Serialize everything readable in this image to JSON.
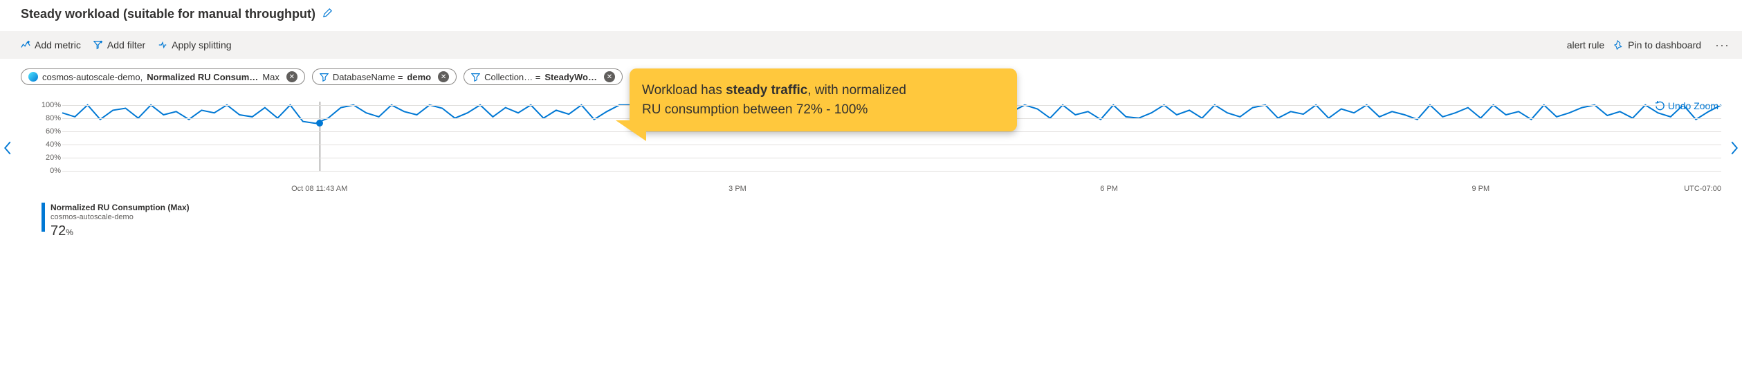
{
  "title": "Steady workload (suitable for manual throughput)",
  "toolbar": {
    "add_metric": "Add metric",
    "add_filter": "Add filter",
    "apply_split": "Apply splitting",
    "alert_rule": "alert rule",
    "pin_dash": "Pin to dashboard"
  },
  "pills": {
    "resource": "cosmos-autoscale-demo,",
    "metric": "Normalized RU Consum…",
    "agg": "Max",
    "filter1_key": "DatabaseName = ",
    "filter1_val": "demo",
    "filter2_key": "Collection… = ",
    "filter2_val": "SteadyWo…"
  },
  "callout": {
    "line1a": "Workload has ",
    "line1b": "steady traffic",
    "line1c": ", with normalized",
    "line2": "RU consumption between 72% - 100%"
  },
  "undo_zoom": "Undo Zoom",
  "timezone": "UTC-07:00",
  "legend": {
    "metric": "Normalized RU Consumption (Max)",
    "resource": "cosmos-autoscale-demo",
    "value": "72",
    "unit": "%"
  },
  "chart_data": {
    "type": "line",
    "ylabel": "",
    "ylim": [
      0,
      105
    ],
    "yticks": [
      0,
      20,
      40,
      60,
      80,
      100
    ],
    "ytick_labels": [
      "0%",
      "20%",
      "40%",
      "60%",
      "80%",
      "100%"
    ],
    "x_ticks": [
      "Oct 08 11:43 AM",
      "3 PM",
      "6 PM",
      "9 PM"
    ],
    "x_tick_positions_pct": [
      15.5,
      40.7,
      63.1,
      85.5
    ],
    "cursor_x_pct": 15.5,
    "cursor_y_val": 72,
    "series": [
      {
        "name": "Normalized RU Consumption (Max)",
        "color": "#0078d4",
        "values": [
          88,
          82,
          100,
          78,
          92,
          95,
          80,
          100,
          85,
          90,
          78,
          92,
          88,
          100,
          85,
          82,
          96,
          80,
          100,
          75,
          72,
          80,
          96,
          100,
          88,
          82,
          100,
          90,
          85,
          100,
          95,
          80,
          88,
          100,
          82,
          96,
          88,
          100,
          80,
          92,
          86,
          100,
          78,
          90,
          100,
          100,
          85,
          78,
          80,
          100,
          82,
          90,
          85,
          100,
          78,
          94,
          88,
          80,
          100,
          85,
          90,
          82,
          100,
          88,
          80,
          100,
          85,
          90,
          78,
          100,
          82,
          96,
          88,
          80,
          100,
          90,
          100,
          94,
          80,
          100,
          85,
          90,
          78,
          100,
          82,
          80,
          88,
          100,
          85,
          92,
          80,
          100,
          88,
          82,
          96,
          100,
          80,
          90,
          86,
          100,
          80,
          94,
          88,
          100,
          82,
          90,
          85,
          78,
          100,
          82,
          88,
          96,
          80,
          100,
          85,
          90,
          78,
          100,
          82,
          88,
          96,
          100,
          84,
          90,
          80,
          100,
          88,
          82,
          100,
          78,
          90,
          100
        ]
      }
    ]
  }
}
